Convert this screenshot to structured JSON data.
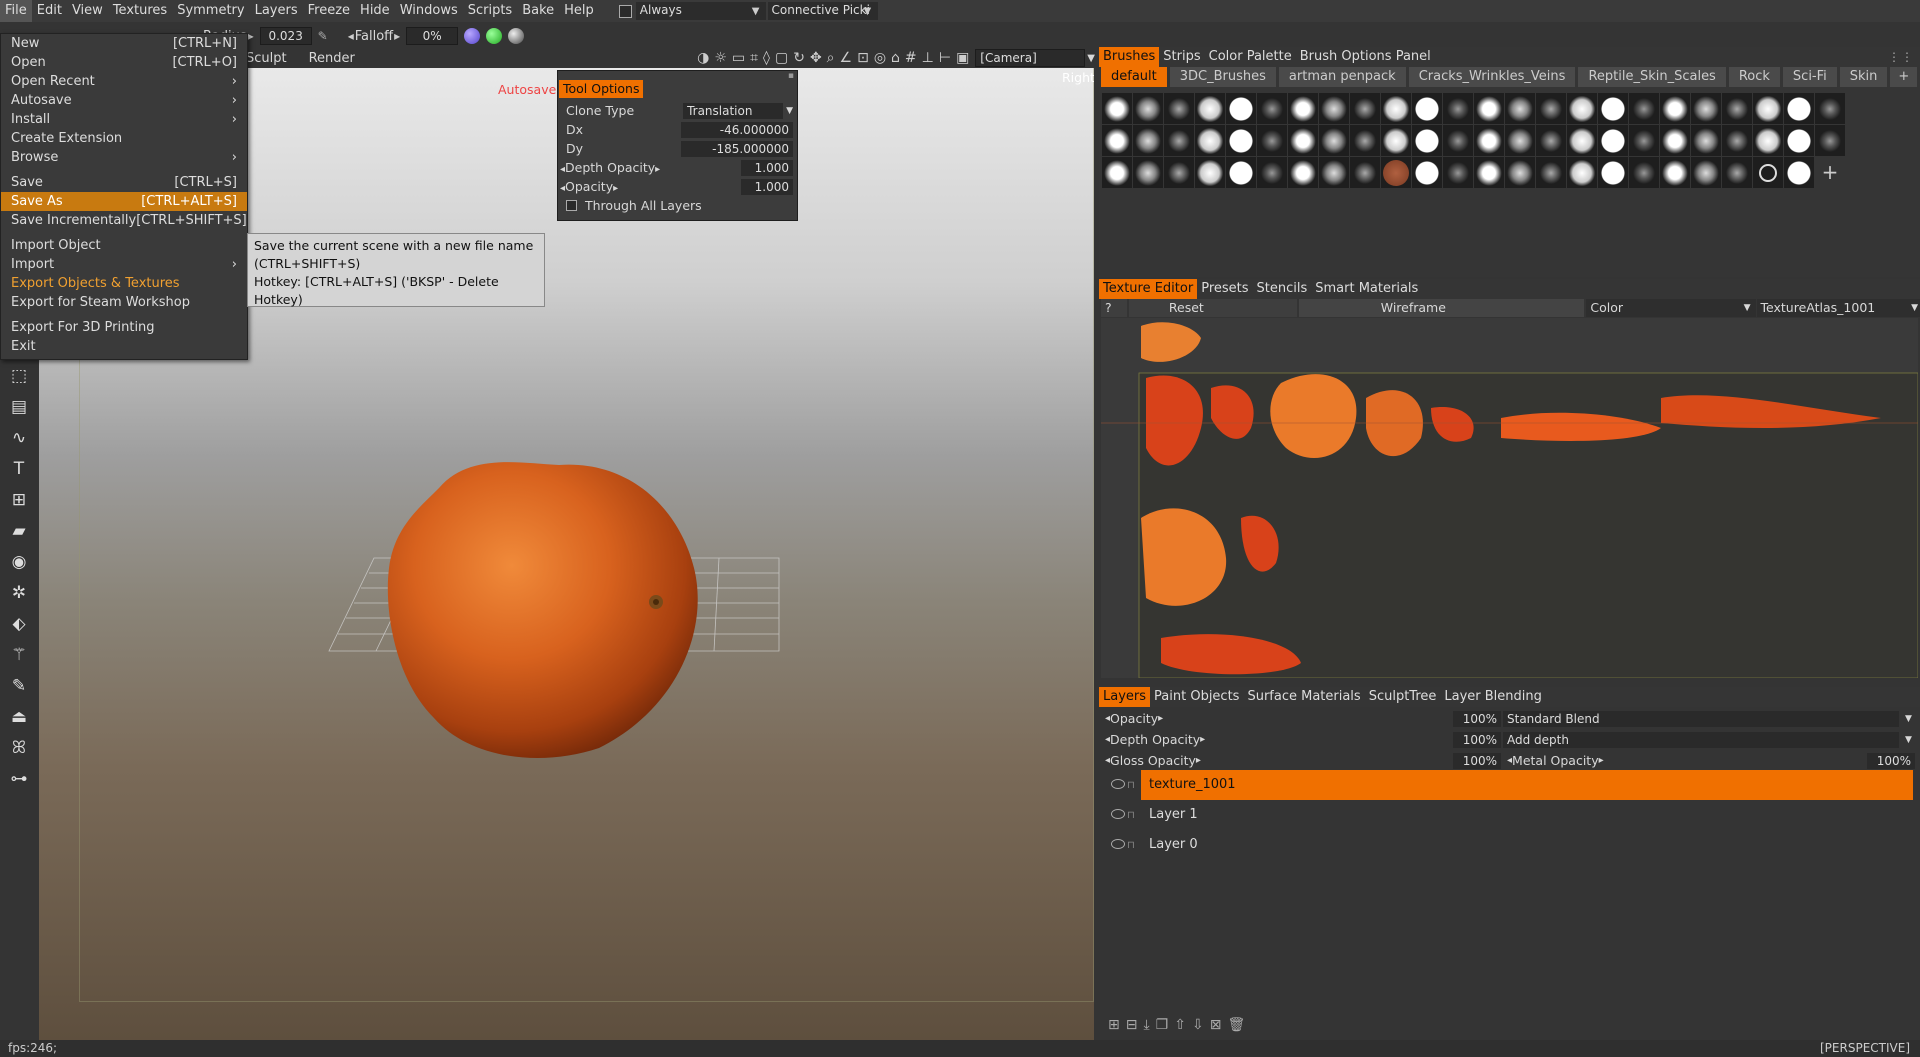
{
  "menubar": {
    "items": [
      "File",
      "Edit",
      "View",
      "Textures",
      "Symmetry",
      "Layers",
      "Freeze",
      "Hide",
      "Windows",
      "Scripts",
      "Bake",
      "Help"
    ],
    "always_label": "Always",
    "connective_label": "Connective Picki"
  },
  "toolbar2": {
    "radius_label": "Radius",
    "radius_value": "0.023",
    "falloff_label": "Falloff",
    "falloff_value": "0%",
    "sculpt_label": "Sculpt",
    "render_label": "Render",
    "camera_value": "[Camera]"
  },
  "file_menu": {
    "items": [
      {
        "label": "New",
        "shortcut": "[CTRL+N]"
      },
      {
        "label": "Open",
        "shortcut": "[CTRL+O]"
      },
      {
        "label": "Open Recent",
        "shortcut": "›"
      },
      {
        "label": "Autosave",
        "shortcut": "›"
      },
      {
        "label": "Install",
        "shortcut": "›"
      },
      {
        "label": "Create Extension",
        "shortcut": ""
      },
      {
        "label": "Browse",
        "shortcut": "›"
      },
      {
        "label": "Save",
        "shortcut": "[CTRL+S]"
      },
      {
        "label": "Save As",
        "shortcut": "[CTRL+ALT+S]"
      },
      {
        "label": "Save Incrementally",
        "shortcut": "[CTRL+SHIFT+S]"
      },
      {
        "label": "Import Object",
        "shortcut": ""
      },
      {
        "label": "Import",
        "shortcut": "›"
      },
      {
        "label": "Export Objects & Textures",
        "shortcut": ""
      },
      {
        "label": "Export for Steam Workshop",
        "shortcut": ""
      },
      {
        "label": "Export For 3D Printing",
        "shortcut": ""
      },
      {
        "label": "Exit",
        "shortcut": ""
      }
    ]
  },
  "tooltip": {
    "line1": "Save the current scene with a new file name",
    "line2": "(CTRL+SHIFT+S)",
    "line3": "Hotkey: [CTRL+ALT+S]   ('BKSP' - Delete",
    "line4": "Hotkey)"
  },
  "viewport": {
    "autosave_label": "Autosave",
    "right_label": "Right"
  },
  "tool_options": {
    "title": "Tool Options",
    "clone_type_label": "Clone Type",
    "clone_type_value": "Translation",
    "dx_label": "Dx",
    "dx_value": "-46.000000",
    "dy_label": "Dy",
    "dy_value": "-185.000000",
    "depth_opacity_label": "Depth Opacity",
    "depth_opacity_value": "1.000",
    "opacity_label": "Opacity",
    "opacity_value": "1.000",
    "through_layers_label": "Through All Layers"
  },
  "brushes_panel": {
    "tabs": [
      "Brushes",
      "Strips",
      "Color Palette",
      "Brush Options Panel"
    ],
    "subtabs": [
      "default",
      "3DC_Brushes",
      "artman penpack",
      "Cracks_Wrinkles_Veins",
      "Reptile_Skin_Scales",
      "Rock",
      "Sci-Fi",
      "Skin"
    ],
    "add_symbol": "+"
  },
  "texture_editor": {
    "tabs": [
      "Texture Editor",
      "Presets",
      "Stencils",
      "Smart Materials"
    ],
    "help_label": "?",
    "reset_label": "Reset",
    "wireframe_label": "Wireframe",
    "channel_value": "Color",
    "atlas_value": "TextureAtlas_1001"
  },
  "layers_panel": {
    "tabs": [
      "Layers",
      "Paint Objects",
      "Surface Materials",
      "SculptTree",
      "Layer Blending"
    ],
    "opacity_label": "Opacity",
    "opacity_value": "100%",
    "blend_value": "Standard Blend",
    "depth_opacity_label": "Depth Opacity",
    "depth_opacity_value": "100%",
    "depth_mode_value": "Add depth",
    "gloss_opacity_label": "Gloss Opacity",
    "gloss_opacity_value": "100%",
    "metal_opacity_label": "Metal Opacity",
    "metal_opacity_value": "100%",
    "layers": [
      {
        "name": "texture_1001",
        "selected": true
      },
      {
        "name": "Layer 1",
        "selected": false
      },
      {
        "name": "Layer 0",
        "selected": false
      }
    ]
  },
  "statusbar": {
    "fps": "fps:246;",
    "view_mode": "[PERSPECTIVE]"
  },
  "colors": {
    "accent": "#f07000",
    "menu_highlight": "#c87a10"
  }
}
